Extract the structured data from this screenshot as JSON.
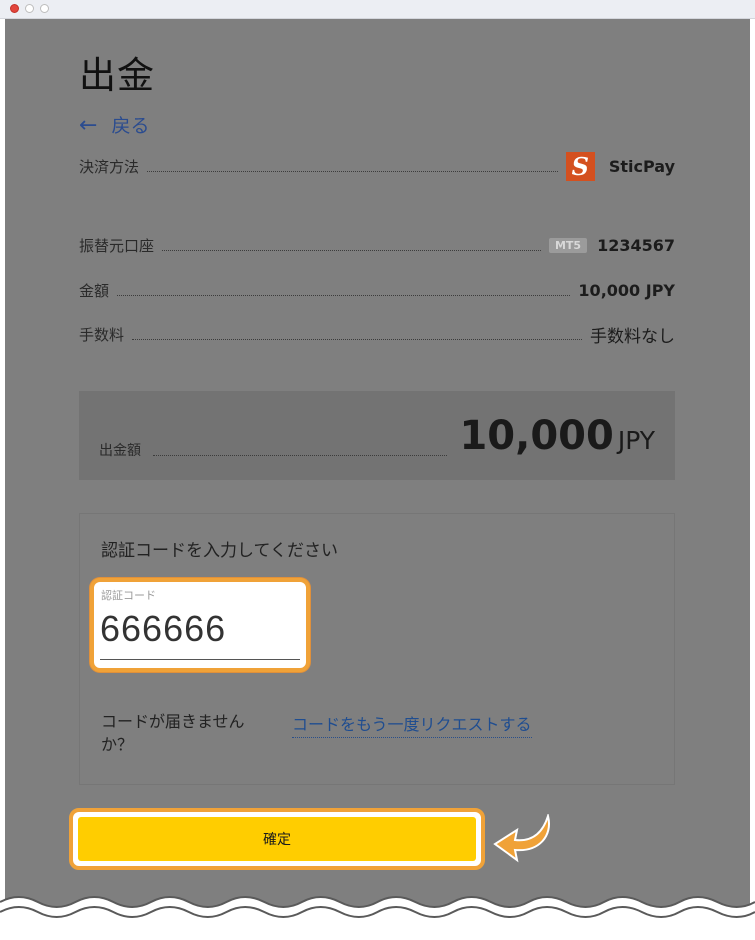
{
  "page": {
    "title": "出金",
    "back_label": "戻る"
  },
  "details": {
    "payment_method_label": "決済方法",
    "payment_method_value": "SticPay",
    "payment_logo_letter": "S",
    "source_account_label": "振替元口座",
    "account_platform_badge": "MT5",
    "account_number": "1234567",
    "amount_label": "金額",
    "amount_value": "10,000 JPY",
    "fee_label": "手数料",
    "fee_value": "手数料なし"
  },
  "total": {
    "label": "出金額",
    "amount": "10,000",
    "currency": "JPY"
  },
  "verification": {
    "prompt": "認証コードを入力してください",
    "field_label": "認証コード",
    "field_value": "666666",
    "no_code_text": "コードが届きませんか？",
    "resend_link": "コードをもう一度リクエストする"
  },
  "actions": {
    "confirm_label": "確定"
  },
  "colors": {
    "overlay_gray": "#7f7f7f",
    "highlight_orange": "#f0a238",
    "button_yellow": "#ffcd00",
    "link_blue": "#1f4d90",
    "sticpay_orange": "#d4501f"
  },
  "icons": {
    "back": "left-arrow-icon",
    "pointer": "curved-arrow-icon"
  }
}
